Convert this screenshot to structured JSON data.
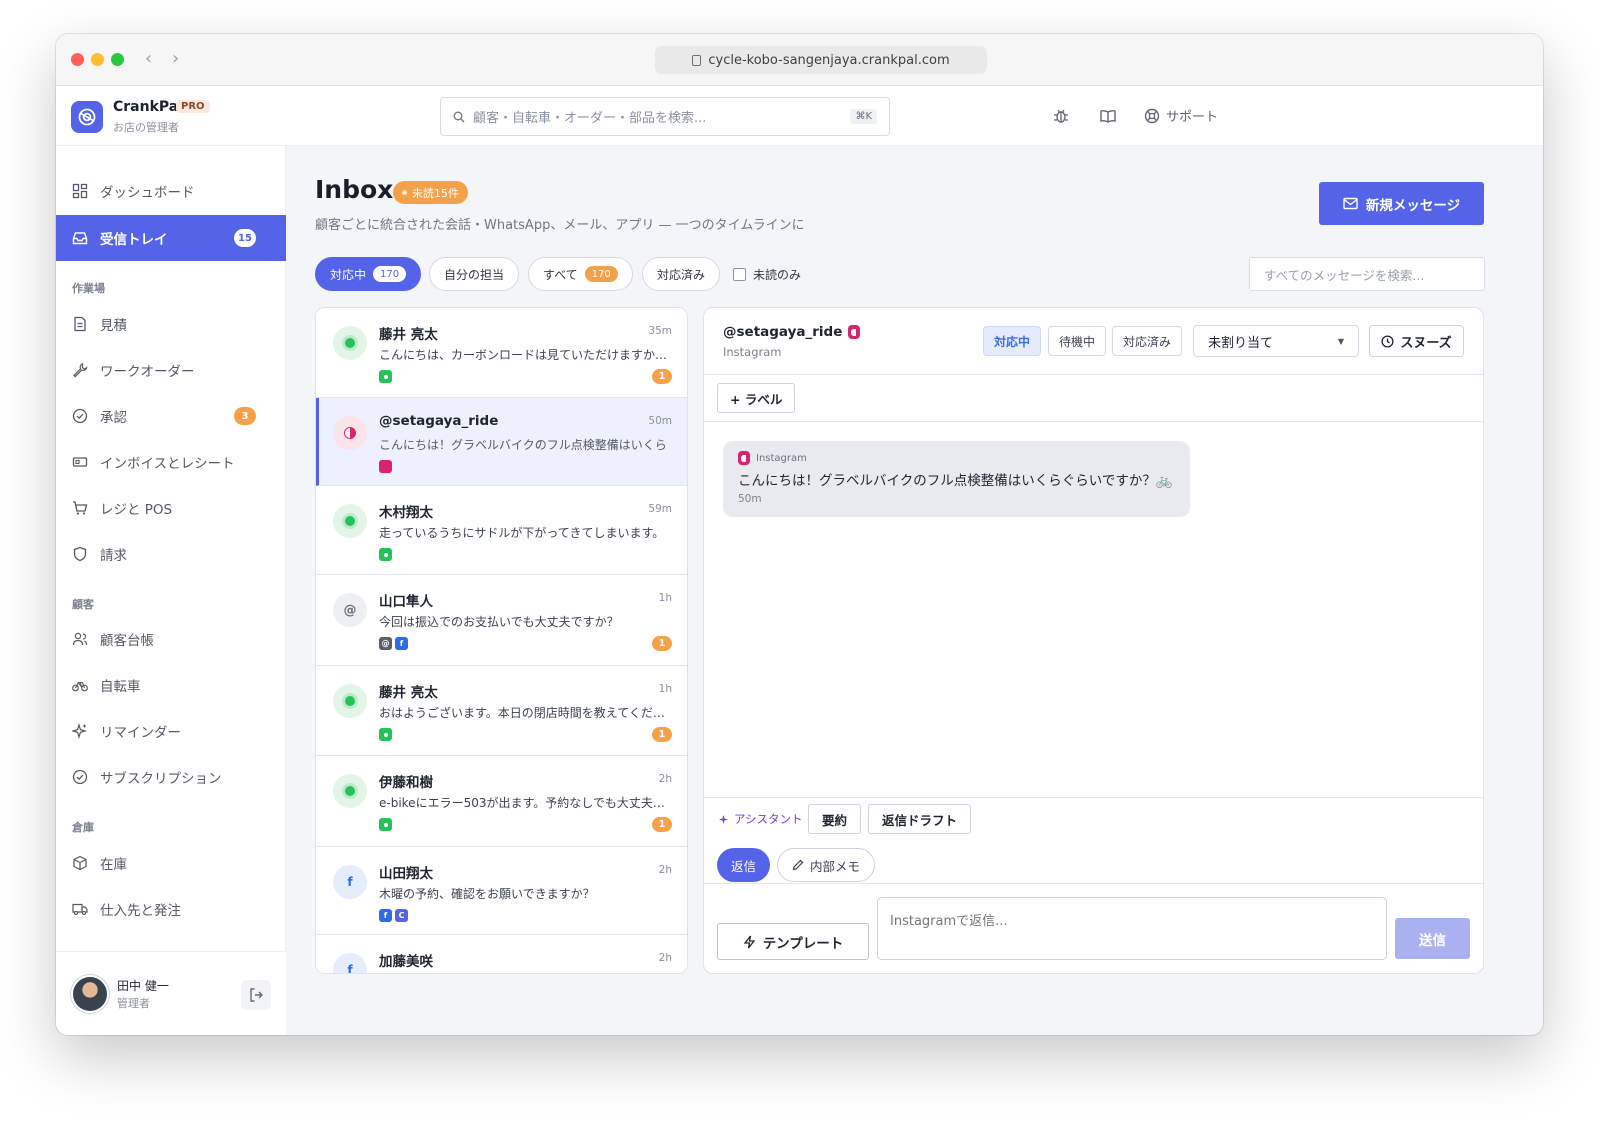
{
  "browser": {
    "url": "cycle-kobo-sangenjaya.crankpal.com"
  },
  "brand": {
    "name": "CrankPal",
    "badge": "PRO",
    "subtitle": "お店の管理者"
  },
  "header": {
    "search_placeholder": "顧客・自転車・オーダー・部品を検索...",
    "search_shortcut": "⌘K",
    "support_label": "サポート"
  },
  "sidebar": {
    "items": [
      {
        "label": "ダッシュボード",
        "icon": "dashboard-icon"
      },
      {
        "label": "受信トレイ",
        "icon": "inbox-icon",
        "badge": "15",
        "active": true
      }
    ],
    "section_workshop": "作業場",
    "workshop_items": [
      {
        "label": "見積",
        "icon": "document-icon"
      },
      {
        "label": "ワークオーダー",
        "icon": "wrench-icon"
      },
      {
        "label": "承認",
        "icon": "check-circle-icon",
        "badge": "3"
      },
      {
        "label": "インボイスとレシート",
        "icon": "receipt-icon"
      },
      {
        "label": "レジと POS",
        "icon": "cart-icon"
      },
      {
        "label": "請求",
        "icon": "shield-icon"
      }
    ],
    "section_customers": "顧客",
    "customer_items": [
      {
        "label": "顧客台帳",
        "icon": "users-icon"
      },
      {
        "label": "自転車",
        "icon": "bicycle-icon"
      },
      {
        "label": "リマインダー",
        "icon": "sparkle-icon"
      },
      {
        "label": "サブスクリプション",
        "icon": "check-circle-icon"
      }
    ],
    "section_warehouse": "倉庫",
    "warehouse_items": [
      {
        "label": "在庫",
        "icon": "box-icon"
      },
      {
        "label": "仕入先と発注",
        "icon": "truck-icon"
      }
    ],
    "user": {
      "name": "田中 健一",
      "role": "管理者"
    }
  },
  "inbox": {
    "title": "Inbox",
    "unread_pill": "未読15件",
    "subtitle": "顧客ごとに統合された会話・WhatsApp、メール、アプリ — 一つのタイムラインに",
    "new_message_label": "新規メッセージ",
    "filters": [
      {
        "label": "対応中",
        "count": "170",
        "active": true
      },
      {
        "label": "自分の担当"
      },
      {
        "label": "すべて",
        "count": "170"
      },
      {
        "label": "対応済み"
      }
    ],
    "unread_only_label": "未読のみ",
    "message_search_placeholder": "すべてのメッセージを検索..."
  },
  "conversations": [
    {
      "name": "藤井 亮太",
      "time": "35m",
      "snippet": "こんにちは、カーボンロードは見ていただけますか…",
      "avatar": "whatsapp",
      "channels": [
        "wa"
      ],
      "count": "1"
    },
    {
      "name": "@setagaya_ride",
      "time": "50m",
      "snippet": "こんにちは！グラベルバイクのフル点検整備はいくら",
      "avatar": "instagram",
      "channels": [
        "ig"
      ],
      "selected": true
    },
    {
      "name": "木村翔太",
      "time": "59m",
      "snippet": "走っているうちにサドルが下がってきてしまいます。",
      "avatar": "whatsapp",
      "channels": [
        "wa"
      ]
    },
    {
      "name": "山口隼人",
      "time": "1h",
      "snippet": "今回は振込でのお支払いでも大丈夫ですか？",
      "avatar": "email",
      "avatar_glyph": "@",
      "channels": [
        "mail",
        "fb"
      ],
      "count": "1"
    },
    {
      "name": "藤井 亮太",
      "time": "1h",
      "snippet": "おはようございます。本日の閉店時間を教えてくだ…",
      "avatar": "whatsapp",
      "channels": [
        "wa"
      ],
      "count": "1"
    },
    {
      "name": "伊藤和樹",
      "time": "2h",
      "snippet": "e-bikeにエラー503が出ます。予約なしでも大丈夫…",
      "avatar": "whatsapp",
      "channels": [
        "wa"
      ],
      "count": "1"
    },
    {
      "name": "山田翔太",
      "time": "2h",
      "snippet": "木曜の予約、確認をお願いできますか？",
      "avatar": "facebook",
      "avatar_glyph": "f",
      "channels": [
        "fb",
        "chat"
      ]
    },
    {
      "name": "加藤美咲",
      "time": "2h",
      "snippet": "",
      "avatar": "facebook",
      "avatar_glyph": "f",
      "channels": []
    }
  ],
  "detail": {
    "name": "@setagaya_ride",
    "channel": "Instagram",
    "status_buttons": [
      "対応中",
      "待機中",
      "対応済み"
    ],
    "assign_value": "未割り当て",
    "snooze_label": "スヌーズ",
    "label_button": "+ ラベル",
    "message": {
      "channel": "Instagram",
      "text": "こんにちは！グラベルバイクのフル点検整備はいくらぐらいですか？🚲",
      "time": "50m"
    },
    "assistant_label": "アシスタント",
    "summary_label": "要約",
    "draft_label": "返信ドラフト",
    "reply_tab": "返信",
    "memo_tab": "内部メモ",
    "template_label": "テンプレート",
    "reply_placeholder": "Instagramで返信...",
    "send_label": "送信"
  },
  "colors": {
    "accent": "#5563e8",
    "badge_orange": "#f5a14a",
    "whatsapp": "#25c25a",
    "instagram": "#d6246e",
    "facebook": "#2e6be6"
  }
}
